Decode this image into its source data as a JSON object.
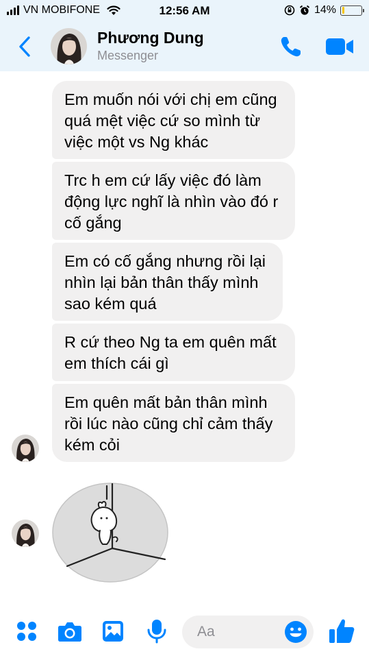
{
  "status_bar": {
    "carrier": "VN MOBIFONE",
    "time": "12:56 AM",
    "battery": "14%",
    "battery_level": 0.14
  },
  "header": {
    "contact_name": "Phương Dung",
    "subtitle": "Messenger",
    "icons": [
      "back-chevron-icon",
      "phone-icon",
      "video-camera-icon"
    ],
    "accent_color": "#0084ff"
  },
  "messages": [
    {
      "text": "Em muốn nói với chị em cũng quá mệt việc cứ so mình từ việc một vs Ng khác"
    },
    {
      "text": "Trc h em cứ lấy việc đó làm động lực nghĩ là nhìn vào đó r cố gắng"
    },
    {
      "text": "Em có cố gắng nhưng rồi lại nhìn lại bản thân thấy mình sao kém quá"
    },
    {
      "text": "R cứ theo Ng ta em quên mất em thích cái gì"
    },
    {
      "text": "Em quên mất bản thân mình rồi lúc nào cũng chỉ cảm thấy kém cỏi"
    }
  ],
  "sticker": {
    "icon": "sad-bunny-sticker"
  },
  "composer": {
    "placeholder": "Aa",
    "icons": [
      "apps-icon",
      "camera-icon",
      "photo-icon",
      "microphone-icon",
      "emoji-icon",
      "thumbs-up-icon"
    ]
  }
}
